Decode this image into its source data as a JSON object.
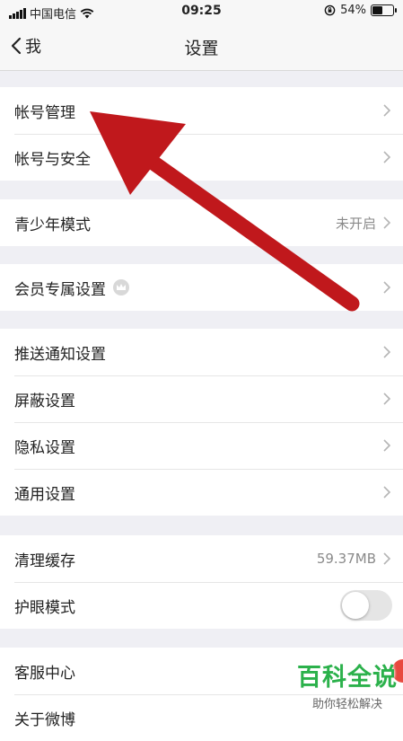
{
  "status_bar": {
    "carrier": "中国电信",
    "time": "09:25",
    "battery_percent": "54%",
    "battery_level": 0.54
  },
  "nav": {
    "back_label": "我",
    "title": "设置"
  },
  "groups": [
    {
      "items": [
        {
          "label": "帐号管理"
        },
        {
          "label": "帐号与安全"
        }
      ]
    },
    {
      "items": [
        {
          "label": "青少年模式",
          "value": "未开启"
        }
      ]
    },
    {
      "items": [
        {
          "label": "会员专属设置",
          "icon": "crown-icon"
        }
      ]
    },
    {
      "items": [
        {
          "label": "推送通知设置"
        },
        {
          "label": "屏蔽设置"
        },
        {
          "label": "隐私设置"
        },
        {
          "label": "通用设置"
        }
      ]
    },
    {
      "items": [
        {
          "label": "清理缓存",
          "value": "59.37MB"
        },
        {
          "label": "护眼模式",
          "toggle": false
        }
      ]
    },
    {
      "items": [
        {
          "label": "客服中心"
        },
        {
          "label": "关于微博"
        }
      ]
    }
  ],
  "watermark": {
    "title": "百科全说",
    "subtitle": "助你轻松解决"
  },
  "colors": {
    "arrow": "#c0181c",
    "watermark": "#2bb14b",
    "badge": "#e8493f"
  }
}
